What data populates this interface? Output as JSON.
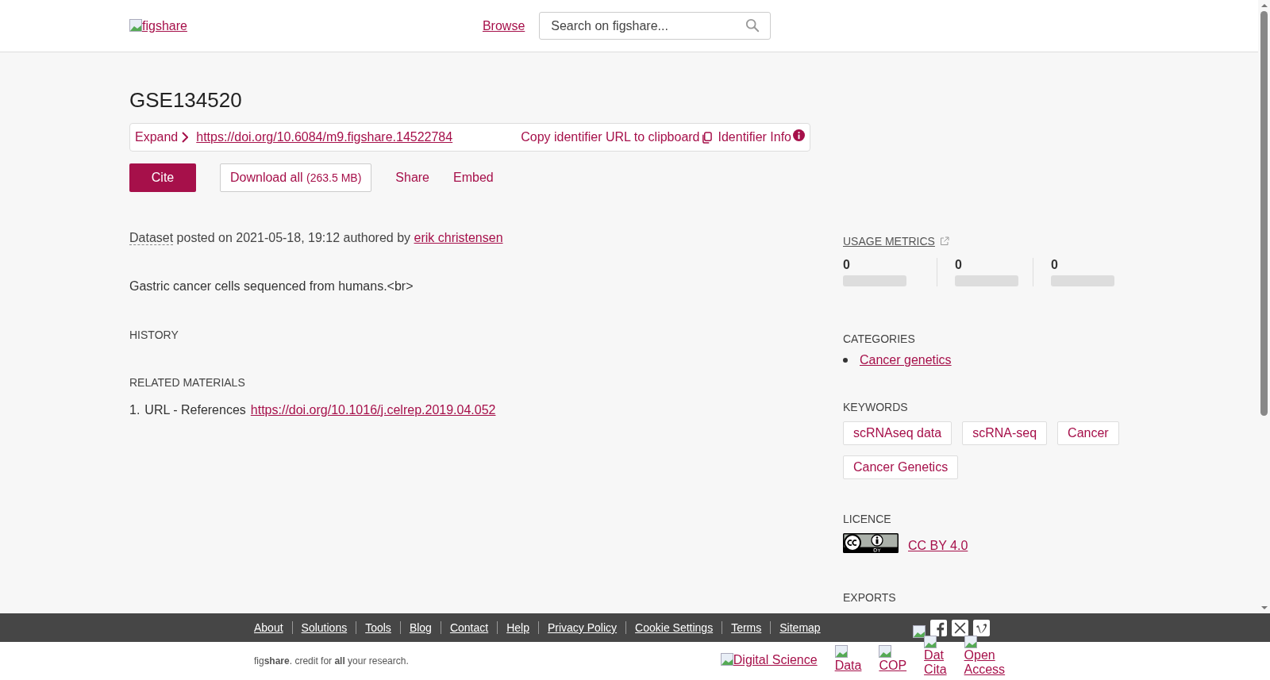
{
  "header": {
    "logo_alt": "figshare",
    "nav_link": "Browse",
    "search": {
      "placeholder": "Search on figshare..."
    }
  },
  "title": "GSE134520",
  "identifier": {
    "expand": "Expand",
    "doi": "https://doi.org/10.6084/m9.figshare.14522784",
    "copy": "Copy identifier URL to clipboard",
    "info": "Identifier Info"
  },
  "actions": {
    "cite": "Cite",
    "download": "Download all",
    "download_size": "(263.5 MB)",
    "share": "Share",
    "embed": "Embed"
  },
  "meta": {
    "type": "Dataset",
    "posted": "posted on 2021-05-18, 19:12 authored by",
    "author": "erik christensen"
  },
  "description": "Gastric cancer cells sequenced from humans.<br>",
  "history": {
    "title": "HISTORY"
  },
  "related": {
    "title": "RELATED MATERIALS",
    "items": [
      {
        "num": "1.",
        "label": "URL - References",
        "link": "https://doi.org/10.1016/j.celrep.2019.04.052"
      }
    ]
  },
  "sidebar": {
    "usage_metrics": {
      "title": "USAGE METRICS",
      "values": [
        "0",
        "0",
        "0"
      ]
    },
    "categories": {
      "title": "CATEGORIES",
      "items": [
        "Cancer genetics"
      ]
    },
    "keywords": {
      "title": "KEYWORDS",
      "items": [
        "scRNAseq data",
        "scRNA-seq",
        "Cancer",
        "Cancer Genetics"
      ]
    },
    "licence": {
      "title": "LICENCE",
      "name": "CC BY 4.0"
    },
    "exports": {
      "title": "EXPORTS"
    }
  },
  "footer": {
    "links": [
      "About",
      "Solutions",
      "Tools",
      "Blog",
      "Contact",
      "Help",
      "Privacy Policy",
      "Cookie Settings",
      "Terms",
      "Sitemap"
    ],
    "tagline": "fig**share**. credit for **all** your research.",
    "partners": [
      {
        "label": "Digital Science",
        "kind": "wide"
      },
      {
        "label": "Data",
        "kind": "narrow"
      },
      {
        "label": "COP",
        "kind": "narrow"
      },
      {
        "label": "Dat Cita",
        "kind": "narrow"
      },
      {
        "label": "Open Access",
        "kind": "raised"
      }
    ]
  }
}
